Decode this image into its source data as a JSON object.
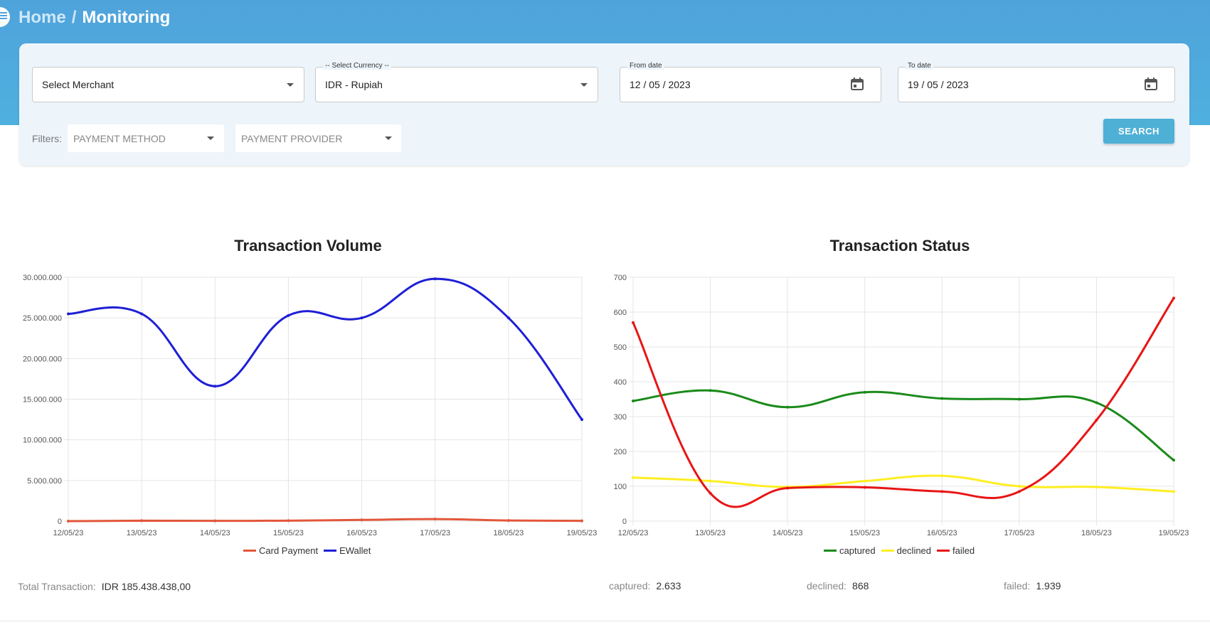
{
  "header": {
    "home": "Home",
    "separator": "/",
    "title": "Monitoring"
  },
  "filters": {
    "merchant": {
      "value": "Select Merchant"
    },
    "currency": {
      "label": "-- Select Currency --",
      "value": "IDR - Rupiah"
    },
    "from_date": {
      "label": "From date",
      "value": "12 / 05 / 2023"
    },
    "to_date": {
      "label": "To date",
      "value": "19 / 05 / 2023"
    },
    "filters_label": "Filters:",
    "payment_method": "PAYMENT METHOD",
    "payment_provider": "PAYMENT PROVIDER",
    "search": "SEARCH"
  },
  "colors": {
    "header": "#4fa3db",
    "card_payment": "#e2573b",
    "ewallet": "#1f1fd6",
    "captured": "#1a8a1a",
    "declined": "#ffee22",
    "failed": "#e81515"
  },
  "chart_data": [
    {
      "type": "line",
      "title": "Transaction Volume",
      "x": [
        "12/05/23",
        "13/05/23",
        "14/05/23",
        "15/05/23",
        "16/05/23",
        "17/05/23",
        "18/05/23",
        "19/05/23"
      ],
      "y_ticks": [
        "0",
        "5.000.000",
        "10.000.000",
        "15.000.000",
        "20.000.000",
        "25.000.000",
        "30.000.000"
      ],
      "ylim": [
        0,
        30000000
      ],
      "series": [
        {
          "name": "Card Payment",
          "color": "#e2573b",
          "values": [
            0,
            50000,
            30000,
            60000,
            150000,
            250000,
            80000,
            30000
          ]
        },
        {
          "name": "EWallet",
          "color": "#1f1fd6",
          "values": [
            25500000,
            25500000,
            16600000,
            25300000,
            25000000,
            29800000,
            25000000,
            12500000
          ]
        }
      ],
      "grid": true,
      "legend": "bottom"
    },
    {
      "type": "line",
      "title": "Transaction Status",
      "x": [
        "12/05/23",
        "13/05/23",
        "14/05/23",
        "15/05/23",
        "16/05/23",
        "17/05/23",
        "18/05/23",
        "19/05/23"
      ],
      "y_ticks": [
        "0",
        "100",
        "200",
        "300",
        "400",
        "500",
        "600",
        "700"
      ],
      "ylim": [
        0,
        700
      ],
      "series": [
        {
          "name": "captured",
          "color": "#1a8a1a",
          "values": [
            345,
            375,
            327,
            370,
            352,
            350,
            340,
            175
          ]
        },
        {
          "name": "declined",
          "color": "#ffee22",
          "values": [
            125,
            115,
            98,
            115,
            130,
            100,
            98,
            85
          ]
        },
        {
          "name": "failed",
          "color": "#e81515",
          "values": [
            570,
            80,
            95,
            97,
            85,
            85,
            290,
            640
          ]
        }
      ],
      "grid": true,
      "legend": "bottom"
    }
  ],
  "summary": {
    "total_label": "Total Transaction:",
    "total_value": "IDR 185.438.438,00",
    "captured_label": "captured:",
    "captured_value": "2.633",
    "declined_label": "declined:",
    "declined_value": "868",
    "failed_label": "failed:",
    "failed_value": "1.939"
  }
}
